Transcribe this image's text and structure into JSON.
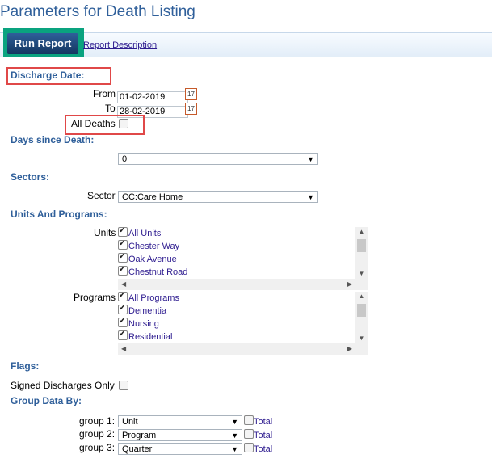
{
  "page": {
    "title": "Parameters for Death Listing"
  },
  "toolbar": {
    "run_label": "Run Report",
    "description_link": "Report Description"
  },
  "discharge": {
    "section_label": "Discharge Date:",
    "from_label": "From",
    "from_value": "01-02-2019",
    "to_label": "To",
    "to_value": "28-02-2019",
    "all_deaths_label": "All Deaths"
  },
  "days_since_death": {
    "section_label": "Days since Death:",
    "selected": "0"
  },
  "sectors": {
    "section_label": "Sectors:",
    "field_label": "Sector",
    "selected": "CC:Care Home"
  },
  "units_programs": {
    "section_label": "Units And Programs:",
    "units_label": "Units",
    "units": [
      "All Units",
      "Chester Way",
      "Oak Avenue",
      "Chestnut Road"
    ],
    "programs_label": "Programs",
    "programs": [
      "All Programs",
      "Dementia",
      "Nursing",
      "Residential"
    ]
  },
  "flags": {
    "section_label": "Flags:",
    "signed_label": "Signed Discharges Only"
  },
  "group_data": {
    "section_label": "Group Data By:",
    "groups": [
      {
        "label": "group 1:",
        "selected": "Unit",
        "total_label": "Total"
      },
      {
        "label": "group 2:",
        "selected": "Program",
        "total_label": "Total"
      },
      {
        "label": "group 3:",
        "selected": "Quarter",
        "total_label": "Total"
      }
    ]
  },
  "icons": {
    "calendar": "calendar-icon",
    "dropdown": "chevron-down-icon"
  }
}
